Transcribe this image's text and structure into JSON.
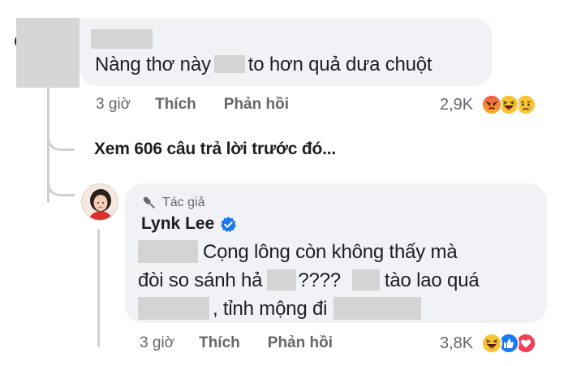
{
  "comment": {
    "text_before": "Nàng thơ này",
    "text_after": "to hơn quả dưa chuột",
    "time": "3 giờ",
    "like_label": "Thích",
    "reply_label": "Phản hồi",
    "reaction_count": "2,9K",
    "reactions": [
      "angry",
      "haha",
      "sad"
    ]
  },
  "view_more": {
    "label": "Xem 606 câu trả lời trước đó..."
  },
  "reply": {
    "author_badge": "Tác giả",
    "author_name": "Lynk Lee",
    "line1": "Cọng lông còn không thấy mà",
    "line2_a": "đòi so sánh hả",
    "line2_b": "????",
    "line2_c": "tào lao quá",
    "line3_a": ", tỉnh mộng đi",
    "time": "3 giờ",
    "like_label": "Thích",
    "reply_label": "Phản hồi",
    "reaction_count": "3,8K",
    "reactions": [
      "haha",
      "like",
      "love"
    ]
  },
  "colors": {
    "bubble": "#f0f2f5",
    "meta_text": "#65676b",
    "verified": "#1877f2",
    "redaction": "#d4d4d4"
  }
}
